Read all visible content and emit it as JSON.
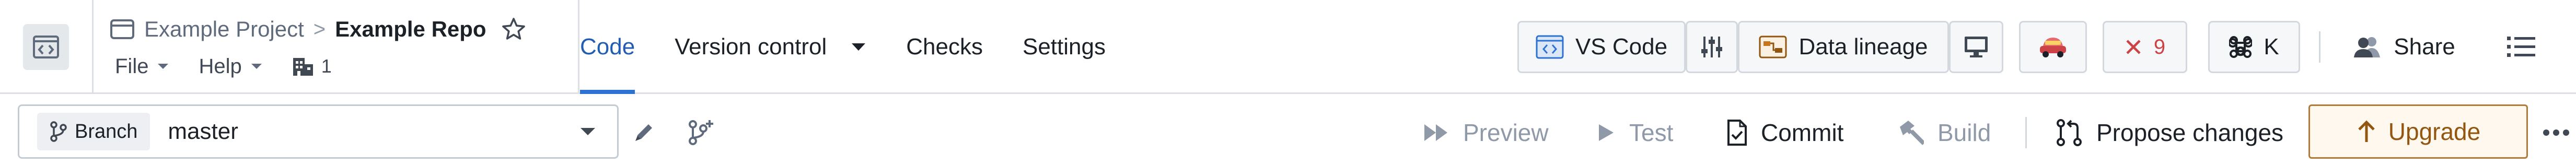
{
  "header": {
    "breadcrumb": {
      "project": "Example Project",
      "separator": ">",
      "repo": "Example Repo"
    },
    "menus": [
      {
        "label": "File"
      },
      {
        "label": "Help"
      }
    ],
    "repo_count": "1",
    "tabs": [
      {
        "label": "Code",
        "active": true
      },
      {
        "label": "Version control",
        "has_dropdown": true
      },
      {
        "label": "Checks"
      },
      {
        "label": "Settings"
      }
    ],
    "toolbar": {
      "vscode_label": "VS Code",
      "data_lineage_label": "Data lineage",
      "error_count": "9",
      "shortcut_key": "K",
      "share_label": "Share"
    }
  },
  "branch_bar": {
    "tag_label": "Branch",
    "branch_name": "master",
    "actions": {
      "preview": "Preview",
      "test": "Test",
      "commit": "Commit",
      "build": "Build",
      "propose": "Propose changes",
      "upgrade": "Upgrade"
    }
  },
  "colors": {
    "accent": "#2d72d2",
    "error": "#cd4246",
    "upgrade": "#935610",
    "border": "#dce0e5"
  }
}
